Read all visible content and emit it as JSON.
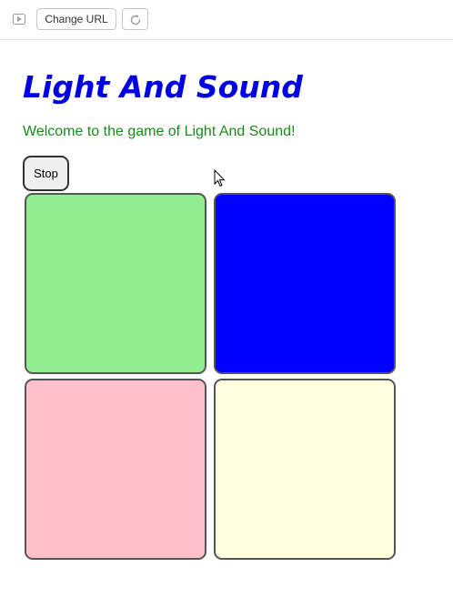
{
  "toolbar": {
    "play_icon": "play-icon",
    "change_url_label": "Change URL",
    "reload_icon": "reload-icon"
  },
  "page": {
    "title": "Light And Sound",
    "welcome": "Welcome to the game of Light And Sound!",
    "stop_label": "Stop"
  },
  "game_buttons": [
    {
      "name": "button-1",
      "color": "#90ee90"
    },
    {
      "name": "button-2",
      "color": "#0000ff"
    },
    {
      "name": "button-3",
      "color": "#ffc0cb"
    },
    {
      "name": "button-4",
      "color": "#ffffe0"
    }
  ],
  "cursor_icon": "mouse-pointer-icon"
}
